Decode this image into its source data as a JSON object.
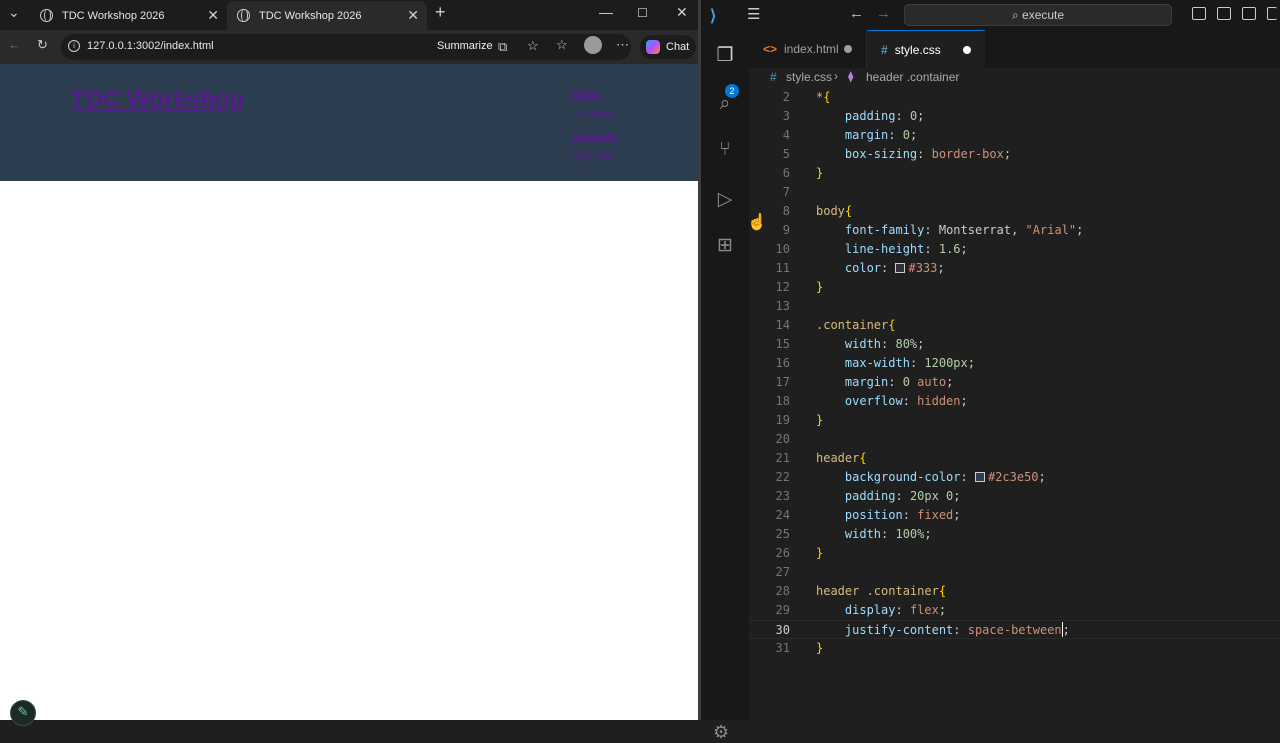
{
  "browser": {
    "tabs": [
      {
        "title": "TDC Workshop 2026"
      },
      {
        "title": "TDC Workshop 2026"
      }
    ],
    "url": "127.0.0.1:3002/index.html",
    "summarize_label": "Summarize",
    "chat_label": "Chat",
    "page": {
      "title": "TDC Workshop",
      "nav": [
        "About",
        "Location",
        "Speakers",
        "Register"
      ],
      "header_color": "#2c3e50",
      "link_color": "#551a8b"
    }
  },
  "vscode": {
    "command_center": "execute",
    "explorer_badge": "2",
    "tabs": [
      {
        "label": "index.html",
        "icon": "html-file-icon",
        "modified": true
      },
      {
        "label": "style.css",
        "icon": "css-file-icon",
        "modified": true
      }
    ],
    "breadcrumbs": {
      "file": "style.css",
      "symbol": "header .container"
    },
    "current_line": 30,
    "lines": [
      {
        "n": "2",
        "tokens": [
          [
            "sel",
            "*"
          ],
          [
            "brace",
            "{"
          ]
        ]
      },
      {
        "n": "3",
        "tokens": [
          [
            "ws",
            "    "
          ],
          [
            "prop",
            "padding"
          ],
          [
            "punc",
            ": "
          ],
          [
            "num",
            "0"
          ],
          [
            "punc",
            ";"
          ]
        ]
      },
      {
        "n": "4",
        "tokens": [
          [
            "ws",
            "    "
          ],
          [
            "prop",
            "margin"
          ],
          [
            "punc",
            ": "
          ],
          [
            "num",
            "0"
          ],
          [
            "punc",
            ";"
          ]
        ]
      },
      {
        "n": "5",
        "tokens": [
          [
            "ws",
            "    "
          ],
          [
            "prop",
            "box-sizing"
          ],
          [
            "punc",
            ": "
          ],
          [
            "val",
            "border-box"
          ],
          [
            "punc",
            ";"
          ]
        ]
      },
      {
        "n": "6",
        "tokens": [
          [
            "brace",
            "}"
          ]
        ]
      },
      {
        "n": "7",
        "tokens": []
      },
      {
        "n": "8",
        "tokens": [
          [
            "sel",
            "body"
          ],
          [
            "brace",
            "{"
          ]
        ]
      },
      {
        "n": "9",
        "tokens": [
          [
            "ws",
            "    "
          ],
          [
            "prop",
            "font-family"
          ],
          [
            "punc",
            ": "
          ],
          [
            "punc",
            "Montserrat, "
          ],
          [
            "val",
            "\"Arial\""
          ],
          [
            "punc",
            ";"
          ]
        ]
      },
      {
        "n": "10",
        "tokens": [
          [
            "ws",
            "    "
          ],
          [
            "prop",
            "line-height"
          ],
          [
            "punc",
            ": "
          ],
          [
            "num",
            "1.6"
          ],
          [
            "punc",
            ";"
          ]
        ]
      },
      {
        "n": "11",
        "tokens": [
          [
            "ws",
            "    "
          ],
          [
            "prop",
            "color"
          ],
          [
            "punc",
            ": "
          ],
          [
            "swatch",
            "#333333"
          ],
          [
            "val",
            "#333"
          ],
          [
            "punc",
            ";"
          ]
        ]
      },
      {
        "n": "12",
        "tokens": [
          [
            "brace",
            "}"
          ]
        ]
      },
      {
        "n": "13",
        "tokens": []
      },
      {
        "n": "14",
        "tokens": [
          [
            "sel",
            ".container"
          ],
          [
            "brace",
            "{"
          ]
        ]
      },
      {
        "n": "15",
        "tokens": [
          [
            "ws",
            "    "
          ],
          [
            "prop",
            "width"
          ],
          [
            "punc",
            ": "
          ],
          [
            "num",
            "80%"
          ],
          [
            "punc",
            ";"
          ]
        ]
      },
      {
        "n": "16",
        "tokens": [
          [
            "ws",
            "    "
          ],
          [
            "prop",
            "max-width"
          ],
          [
            "punc",
            ": "
          ],
          [
            "num",
            "1200px"
          ],
          [
            "punc",
            ";"
          ]
        ]
      },
      {
        "n": "17",
        "tokens": [
          [
            "ws",
            "    "
          ],
          [
            "prop",
            "margin"
          ],
          [
            "punc",
            ": "
          ],
          [
            "num",
            "0 "
          ],
          [
            "val",
            "auto"
          ],
          [
            "punc",
            ";"
          ]
        ]
      },
      {
        "n": "18",
        "tokens": [
          [
            "ws",
            "    "
          ],
          [
            "prop",
            "overflow"
          ],
          [
            "punc",
            ": "
          ],
          [
            "val",
            "hidden"
          ],
          [
            "punc",
            ";"
          ]
        ]
      },
      {
        "n": "19",
        "tokens": [
          [
            "brace",
            "}"
          ]
        ]
      },
      {
        "n": "20",
        "tokens": []
      },
      {
        "n": "21",
        "tokens": [
          [
            "sel",
            "header"
          ],
          [
            "brace",
            "{"
          ]
        ]
      },
      {
        "n": "22",
        "tokens": [
          [
            "ws",
            "    "
          ],
          [
            "prop",
            "background-color"
          ],
          [
            "punc",
            ": "
          ],
          [
            "swatch",
            "#2c3e50"
          ],
          [
            "val",
            "#2c3e50"
          ],
          [
            "punc",
            ";"
          ]
        ]
      },
      {
        "n": "23",
        "tokens": [
          [
            "ws",
            "    "
          ],
          [
            "prop",
            "padding"
          ],
          [
            "punc",
            ": "
          ],
          [
            "num",
            "20px 0"
          ],
          [
            "punc",
            ";"
          ]
        ]
      },
      {
        "n": "24",
        "tokens": [
          [
            "ws",
            "    "
          ],
          [
            "prop",
            "position"
          ],
          [
            "punc",
            ": "
          ],
          [
            "val",
            "fixed"
          ],
          [
            "punc",
            ";"
          ]
        ]
      },
      {
        "n": "25",
        "tokens": [
          [
            "ws",
            "    "
          ],
          [
            "prop",
            "width"
          ],
          [
            "punc",
            ": "
          ],
          [
            "num",
            "100%"
          ],
          [
            "punc",
            ";"
          ]
        ]
      },
      {
        "n": "26",
        "tokens": [
          [
            "brace",
            "}"
          ]
        ]
      },
      {
        "n": "27",
        "tokens": []
      },
      {
        "n": "28",
        "tokens": [
          [
            "sel",
            "header .container"
          ],
          [
            "brace",
            "{"
          ]
        ]
      },
      {
        "n": "29",
        "tokens": [
          [
            "ws",
            "    "
          ],
          [
            "prop",
            "display"
          ],
          [
            "punc",
            ": "
          ],
          [
            "val",
            "flex"
          ],
          [
            "punc",
            ";"
          ]
        ]
      },
      {
        "n": "30",
        "tokens": [
          [
            "ws",
            "    "
          ],
          [
            "prop",
            "justify-content"
          ],
          [
            "punc",
            ": "
          ],
          [
            "val",
            "space-between"
          ],
          [
            "caret",
            ""
          ],
          [
            "punc",
            ";"
          ]
        ]
      },
      {
        "n": "31",
        "tokens": [
          [
            "brace",
            "}"
          ]
        ]
      }
    ]
  }
}
